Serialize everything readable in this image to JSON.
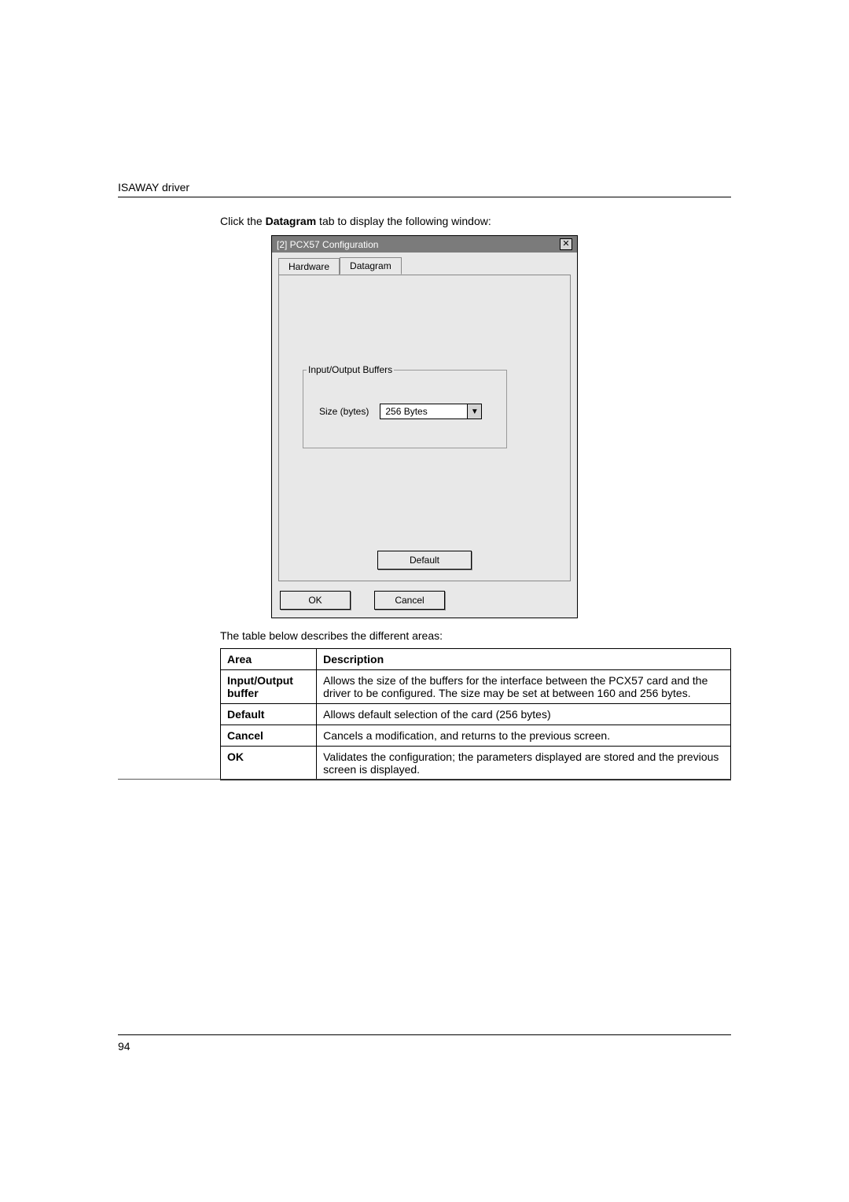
{
  "header": {
    "driver_name": "ISAWAY driver"
  },
  "intro": {
    "prefix": "Click the ",
    "bold": "Datagram",
    "suffix": " tab to display the following window:"
  },
  "dialog": {
    "title": "[2] PCX57 Configuration",
    "close": "✕",
    "tabs": {
      "hardware": "Hardware",
      "datagram": "Datagram"
    },
    "groupbox_legend": "Input/Output Buffers",
    "size_label": "Size (bytes)",
    "size_value": "256 Bytes",
    "default_btn": "Default",
    "ok_btn": "OK",
    "cancel_btn": "Cancel"
  },
  "table_caption": "The table below describes the different areas:",
  "table": {
    "headers": {
      "area": "Area",
      "desc": "Description"
    },
    "rows": [
      {
        "area": "Input/Output buffer",
        "desc": "Allows the size of the buffers for the interface between the PCX57 card and the driver to be configured. The size may be set at between 160 and 256 bytes."
      },
      {
        "area": "Default",
        "desc": "Allows default selection of the card (256 bytes)"
      },
      {
        "area": "Cancel",
        "desc": "Cancels a modification, and returns to the previous screen."
      },
      {
        "area": "OK",
        "desc": "Validates the configuration; the parameters displayed are stored and the previous screen is displayed."
      }
    ]
  },
  "page_number": "94"
}
